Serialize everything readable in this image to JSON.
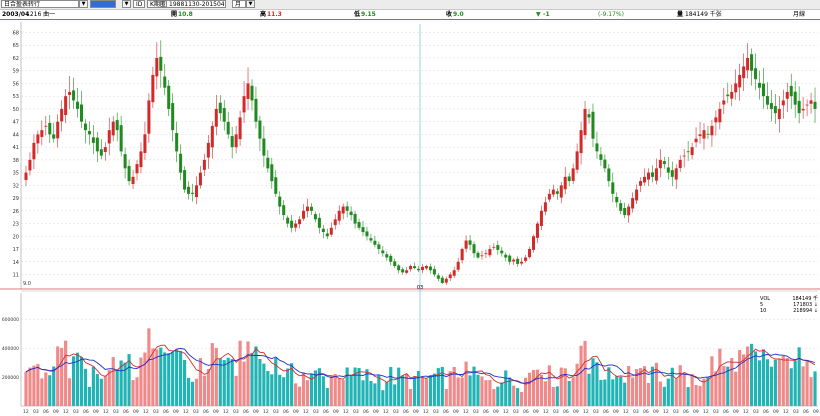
{
  "toolbar": {
    "stock_selector": "日合盈表转行",
    "highlight_field": "",
    "id_label": "ID",
    "period_button": "K期匿",
    "date_range": "19881130-20150413",
    "period_type": "月"
  },
  "infobar": {
    "date": "2003/04",
    "weekday": "1216 曲一",
    "open_label": "開",
    "open_value": "10.8",
    "high_label": "高",
    "high_value": "11.3",
    "low_label": "低",
    "low_value": "9.15",
    "close_label": "收",
    "close_value": "9.0",
    "change_label": "▼",
    "change_value": "-1",
    "change_pct": "(-9.17%)",
    "volume_label": "量",
    "volume_value": "184149 千张",
    "period_label": "月線"
  },
  "cursor_label": "9.0",
  "cursor_date": "03",
  "volume_legend": [
    {
      "label": "VOL",
      "value": "184149 千"
    },
    {
      "label": "5",
      "value": "171803 ↓"
    },
    {
      "label": "10",
      "value": "218994 ↓"
    }
  ],
  "colors": {
    "up": "#d22a2a",
    "down": "#1f8a1f",
    "vol_up": "#f08a8a",
    "vol_down": "#22b4b4",
    "ma5": "#d23030",
    "ma10": "#2030c8",
    "crosshair": "#5ab4e0",
    "divider": "#d05050"
  },
  "chart_data": [
    {
      "type": "candlestick",
      "title": "",
      "ylim": [
        9,
        70
      ],
      "y_ticks": [
        11,
        14,
        17,
        20,
        23,
        26,
        29,
        32,
        35,
        38,
        41,
        44,
        47,
        50,
        53,
        56,
        59,
        62,
        65,
        68
      ],
      "grid": true,
      "closes_approx": [
        35,
        38,
        42,
        44,
        45,
        46,
        44,
        43,
        47,
        50,
        53,
        54,
        52,
        50,
        47,
        45,
        44,
        42,
        40,
        39,
        41,
        45,
        47,
        45,
        40,
        36,
        33,
        34,
        37,
        40,
        44,
        52,
        58,
        62,
        59,
        55,
        50,
        45,
        40,
        35,
        31,
        30,
        30,
        32,
        35,
        38,
        42,
        46,
        50,
        49,
        47,
        44,
        41,
        44,
        48,
        53,
        56,
        52,
        47,
        43,
        39,
        36,
        33,
        30,
        27,
        25,
        23,
        22,
        23,
        24,
        26,
        27,
        26,
        24,
        22,
        21,
        20,
        22,
        24,
        26,
        27,
        26,
        25,
        23,
        22,
        21,
        20,
        19,
        18,
        17,
        16,
        15,
        14,
        13,
        12,
        11.5,
        12,
        13,
        12.5,
        12,
        12.8,
        13,
        12,
        11,
        10,
        9,
        10,
        11,
        12,
        14,
        17,
        19,
        18,
        16,
        15,
        15.5,
        16,
        17,
        17.5,
        16.8,
        16,
        15,
        14,
        14.5,
        13.5,
        14,
        15,
        17,
        20,
        23,
        26,
        28,
        30,
        31,
        30,
        32,
        34,
        33,
        36,
        40,
        45,
        50,
        48,
        43,
        40,
        38,
        36,
        33,
        30,
        28,
        26,
        25,
        27,
        29,
        31,
        33,
        34,
        35,
        34,
        36,
        38,
        37,
        35,
        34,
        36,
        38,
        39,
        40,
        41,
        43,
        44,
        45,
        44,
        46,
        48,
        50,
        52,
        53,
        54,
        56,
        58,
        60,
        62,
        59,
        57,
        55,
        53,
        51,
        50,
        49,
        50,
        52,
        54,
        53,
        51,
        49,
        50,
        51,
        52,
        50
      ]
    },
    {
      "type": "bar",
      "title": "volume",
      "y_ticks": [
        200000,
        400000,
        600000
      ],
      "ylim": [
        0,
        760000
      ],
      "series_names": [
        "VOL",
        "5",
        "10"
      ]
    }
  ]
}
